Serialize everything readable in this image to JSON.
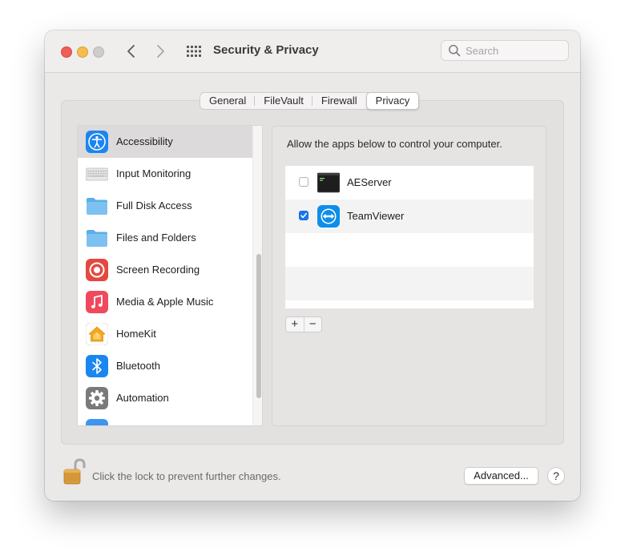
{
  "window": {
    "title": "Security & Privacy"
  },
  "search": {
    "placeholder": "Search",
    "value": ""
  },
  "tabs": [
    {
      "label": "General",
      "active": false
    },
    {
      "label": "FileVault",
      "active": false
    },
    {
      "label": "Firewall",
      "active": false
    },
    {
      "label": "Privacy",
      "active": true
    }
  ],
  "sidebar": {
    "items": [
      {
        "label": "Accessibility",
        "icon": "accessibility-icon",
        "selected": true
      },
      {
        "label": "Input Monitoring",
        "icon": "keyboard-icon",
        "selected": false
      },
      {
        "label": "Full Disk Access",
        "icon": "folder-icon",
        "selected": false
      },
      {
        "label": "Files and Folders",
        "icon": "folder-icon",
        "selected": false
      },
      {
        "label": "Screen Recording",
        "icon": "screen-recording-icon",
        "selected": false
      },
      {
        "label": "Media & Apple Music",
        "icon": "music-icon",
        "selected": false
      },
      {
        "label": "HomeKit",
        "icon": "home-icon",
        "selected": false
      },
      {
        "label": "Bluetooth",
        "icon": "bluetooth-icon",
        "selected": false
      },
      {
        "label": "Automation",
        "icon": "gear-icon",
        "selected": false
      }
    ]
  },
  "panel": {
    "description": "Allow the apps below to control your computer.",
    "apps": [
      {
        "name": "AEServer",
        "checked": false,
        "icon": "terminal-icon"
      },
      {
        "name": "TeamViewer",
        "checked": true,
        "icon": "teamviewer-icon"
      }
    ],
    "add_label": "+",
    "remove_label": "−"
  },
  "footer": {
    "lock_text": "Click the lock to prevent further changes.",
    "advanced_label": "Advanced...",
    "help_label": "?"
  },
  "colors": {
    "accent": "#1877f2",
    "window_bg": "#ebe8e8",
    "selection": "#dcdada"
  }
}
